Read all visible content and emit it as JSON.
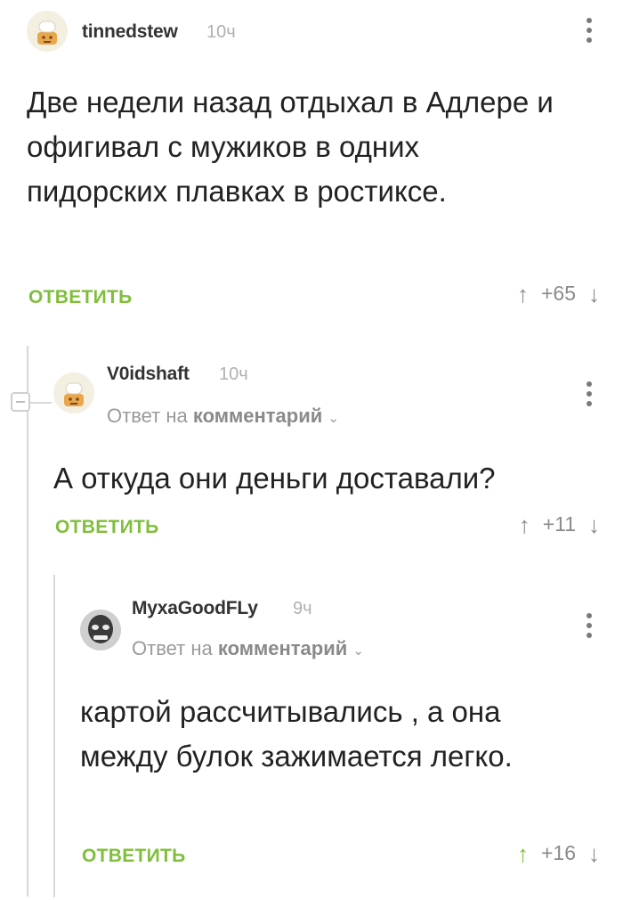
{
  "comments": [
    {
      "username": "tinnedstew",
      "time": "10ч",
      "text": "Две недели назад отдыхал в Адлере и офигивал с мужиков в одних пидорских плавках в ростиксе.",
      "reply_label": "ОТВЕТИТЬ",
      "rating": "+65",
      "avatar_icon": "chef-avatar-icon"
    },
    {
      "username": "V0idshaft",
      "time": "10ч",
      "reply_to_prefix": "Ответ на",
      "reply_to_target": "комментарий",
      "text": "А откуда они деньги доставали?",
      "reply_label": "ОТВЕТИТЬ",
      "rating": "+11",
      "avatar_icon": "chef-avatar-icon"
    },
    {
      "username": "MyxaGoodFLy",
      "time": "9ч",
      "reply_to_prefix": "Ответ на",
      "reply_to_target": "комментарий",
      "text": "картой рассчитывались , а она между булок зажимается легко.",
      "reply_label": "ОТВЕТИТЬ",
      "rating": "+16",
      "avatar_icon": "photo-avatar-icon",
      "upvoted": true
    }
  ],
  "colors": {
    "accent": "#7fbf3b",
    "muted": "#8a8a8a",
    "text": "#222222"
  }
}
